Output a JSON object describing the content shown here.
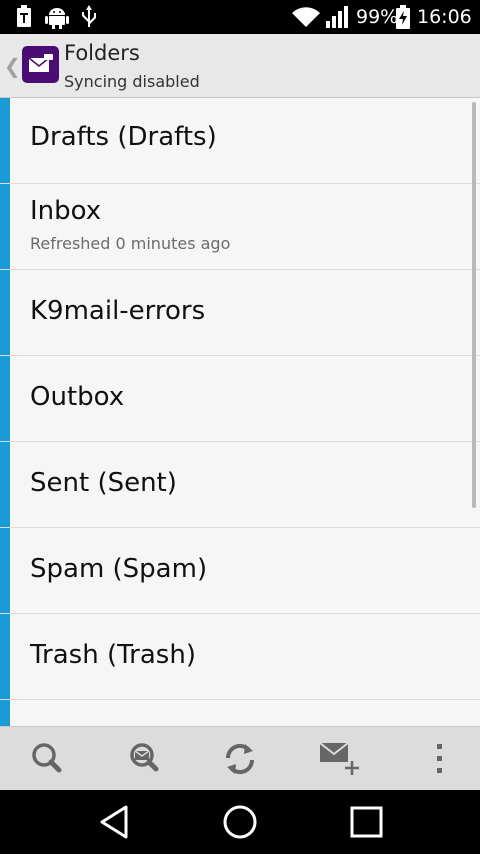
{
  "status_bar": {
    "battery_percent": "99%",
    "time": "16:06",
    "icons": [
      "usb-debug-icon",
      "android-debug-icon",
      "usb-icon",
      "wifi-icon",
      "signal-icon",
      "battery-icon"
    ]
  },
  "action_bar": {
    "title": "Folders",
    "subtitle": "Syncing disabled",
    "app_icon": "mail-app-icon"
  },
  "folders": [
    {
      "name": "Drafts (Drafts)",
      "status": ""
    },
    {
      "name": "Inbox",
      "status": "Refreshed 0 minutes ago"
    },
    {
      "name": "K9mail-errors",
      "status": ""
    },
    {
      "name": "Outbox",
      "status": ""
    },
    {
      "name": "Sent (Sent)",
      "status": ""
    },
    {
      "name": "Spam (Spam)",
      "status": ""
    },
    {
      "name": "Trash (Trash)",
      "status": ""
    }
  ],
  "colors": {
    "folder_accent": "#1a9ad6",
    "app_icon_bg": "#4a0d74"
  },
  "bottom_bar": {
    "buttons": [
      "search-icon",
      "search-remote-icon",
      "refresh-icon",
      "compose-icon",
      "overflow-menu-icon"
    ]
  },
  "nav_bar": {
    "buttons": [
      "back-icon",
      "home-icon",
      "recents-icon"
    ]
  }
}
